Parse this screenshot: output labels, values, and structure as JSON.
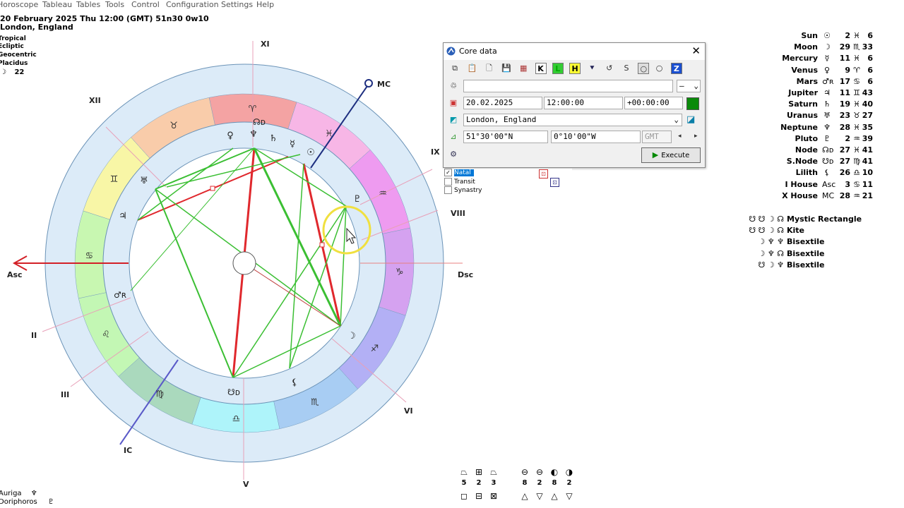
{
  "menu": [
    "Horoscope",
    "Tableau",
    "Tables",
    "Tools",
    "Control",
    "Configuration",
    "Settings",
    "Help"
  ],
  "header": {
    "date_line": "20 February 2025  Thu  12:00 (GMT) 51n30  0w10",
    "place_line": "London, England",
    "settings": [
      "Tropical",
      "Ecliptic",
      "Geocentric",
      "Placidus"
    ],
    "moon_phase_glyph": "☽",
    "moon_phase_value": "22"
  },
  "wheel": {
    "house_labels": {
      "xi": "XI",
      "xii": "XII",
      "mc": "MC",
      "ix": "IX",
      "viii": "VIII",
      "asc": "Asc",
      "dsc": "Dsc",
      "ii": "II",
      "iii": "III",
      "ic": "IC",
      "v": "V",
      "vi": "VI"
    },
    "sign_glyphs": [
      "♈",
      "♓",
      "♒",
      "♑",
      "♐",
      "♏",
      "♎",
      "♍",
      "♌",
      "♋",
      "♊",
      "♉"
    ],
    "sign_colors": [
      "#f4a3a3",
      "#f7b6e6",
      "#ee9bf0",
      "#d5a2f0",
      "#b3b0f5",
      "#a8cdf3",
      "#aef4fa",
      "#aad9bd",
      "#c3f7b4",
      "#c8f7b1",
      "#f8f6a6",
      "#f9ccaa"
    ],
    "planet_glyphs": {
      "venus": "♀",
      "neptune": "♆",
      "saturn": "♄",
      "mercury": "☿",
      "sun": "☉",
      "pluto": "♇",
      "moon": "☽",
      "lilith": "⚸",
      "snode": "☋ᴅ",
      "mars": "♂ʀ",
      "jupiter": "♃",
      "uranus": "♅",
      "node": "☊ᴅ"
    },
    "accent_red": "#e0282d",
    "accent_green": "#3bbf33",
    "mc_axis_color": "#1e2f80",
    "ic_axis_color": "#5555cc"
  },
  "planets": [
    {
      "name": "Sun",
      "glyph": "☉",
      "deg": "2",
      "sign": "♓",
      "min": "6"
    },
    {
      "name": "Moon",
      "glyph": "☽",
      "deg": "29",
      "sign": "♏",
      "min": "33"
    },
    {
      "name": "Mercury",
      "glyph": "☿",
      "deg": "11",
      "sign": "♓",
      "min": "6"
    },
    {
      "name": "Venus",
      "glyph": "♀",
      "deg": "9",
      "sign": "♈",
      "min": "6"
    },
    {
      "name": "Mars",
      "glyph": "♂ʀ",
      "deg": "17",
      "sign": "♋",
      "min": "6"
    },
    {
      "name": "Jupiter",
      "glyph": "♃",
      "deg": "11",
      "sign": "♊",
      "min": "43"
    },
    {
      "name": "Saturn",
      "glyph": "♄",
      "deg": "19",
      "sign": "♓",
      "min": "40"
    },
    {
      "name": "Uranus",
      "glyph": "♅",
      "deg": "23",
      "sign": "♉",
      "min": "27"
    },
    {
      "name": "Neptune",
      "glyph": "♆",
      "deg": "28",
      "sign": "♓",
      "min": "35"
    },
    {
      "name": "Pluto",
      "glyph": "♇",
      "deg": "2",
      "sign": "♒",
      "min": "39"
    },
    {
      "name": "Node",
      "glyph": "☊ᴅ",
      "deg": "27",
      "sign": "♓",
      "min": "41"
    },
    {
      "name": "S.Node",
      "glyph": "☋ᴅ",
      "deg": "27",
      "sign": "♍",
      "min": "41"
    },
    {
      "name": "Lilith",
      "glyph": "⚸",
      "deg": "26",
      "sign": "♎",
      "min": "10"
    },
    {
      "name": "I House",
      "glyph": "Asc",
      "deg": "3",
      "sign": "♋",
      "min": "11"
    },
    {
      "name": "X House",
      "glyph": "MC",
      "deg": "28",
      "sign": "♒",
      "min": "21"
    }
  ],
  "aspect_patterns": [
    {
      "glyphs": "☋ ☋ ☽ ☊",
      "name": "Mystic Rectangle"
    },
    {
      "glyphs": "☋ ☋ ☽ ☊",
      "name": "Kite"
    },
    {
      "glyphs": "☽ ♆ ♆",
      "name": "Bisextile"
    },
    {
      "glyphs": "☽ ♆ ☊",
      "name": "Bisextile"
    },
    {
      "glyphs": "☋ ☽ ♆",
      "name": "Bisextile"
    }
  ],
  "dialog": {
    "title": "Core data",
    "close_glyph": "✕",
    "toolbar": [
      "⧉",
      "📋",
      "🗋",
      "💾",
      "▦",
      "K",
      "L",
      "H",
      "⯆",
      "↺",
      "S",
      "○",
      "○",
      "Z"
    ],
    "name_value": "",
    "name_dropdown": "–",
    "date_value": "20.02.2025",
    "time_value": "12:00:00",
    "offset_value": "+00:00:00",
    "place_value": "London, England",
    "lat_value": "51°30'00\"N",
    "lon_value": "0°10'00\"W",
    "tz_value": "GMT",
    "execute_label": "Execute"
  },
  "chart_list": [
    {
      "label": "Natal",
      "checked": true,
      "selected": true
    },
    {
      "label": "Transit",
      "checked": false,
      "selected": false
    },
    {
      "label": "Synastry",
      "checked": false,
      "selected": false
    }
  ],
  "bottom_stats": [
    {
      "glyph": "⏢",
      "value": "5"
    },
    {
      "glyph": "⊞",
      "value": "2"
    },
    {
      "glyph": "⏢",
      "value": "3"
    },
    {
      "glyph": "⊖",
      "value": "8"
    },
    {
      "glyph": "⊖",
      "value": "2"
    },
    {
      "glyph": "◐",
      "value": "8"
    },
    {
      "glyph": "◑",
      "value": "2"
    }
  ],
  "bottom_stats_row2": [
    "◻",
    "⊟",
    "⊠",
    "△",
    "▽",
    "△",
    "▽"
  ],
  "footer": {
    "line1": "Auriga",
    "line1_glyph": "♆",
    "line2": "Doriphoros",
    "line2_glyph": "♇"
  }
}
